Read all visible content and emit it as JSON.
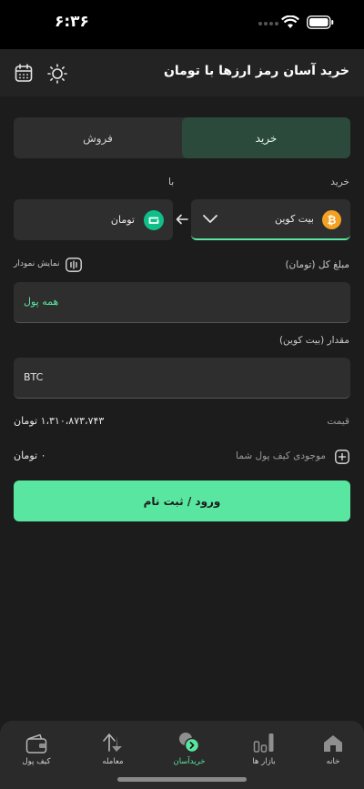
{
  "status_bar": {
    "time": "۶:۳۶"
  },
  "header": {
    "title": "خرید آسان رمز ارزها با تومان"
  },
  "tabs": {
    "buy": "خرید",
    "sell": "فروش"
  },
  "labels": {
    "buy": "خرید",
    "with": "با"
  },
  "coin": {
    "name": "بیت کوین",
    "symbol": "₿"
  },
  "fiat": {
    "name": "تومان"
  },
  "total": {
    "label": "مبلغ کل (تومان)",
    "chart_toggle": "نمایش نمودار",
    "value": "همه پول"
  },
  "amount": {
    "label": "مقدار (بیت کوین)",
    "value": "BTC"
  },
  "price": {
    "label": "قیمت",
    "value": "۱،۳۱۰،۸۷۳،۷۴۳ تومان"
  },
  "balance": {
    "label": "موجودی کیف پول شما",
    "value": "۰ تومان"
  },
  "login_button": "ورود / ثبت نام",
  "nav": {
    "home": "خانه",
    "markets": "بازار ها",
    "easy_buy": "خریدآسان",
    "trade": "معامله",
    "wallet": "کیف پول"
  },
  "colors": {
    "accent": "#59e6a0",
    "active_tab": "#2c4a3c",
    "btc": "#f2a122",
    "toman": "#0fbf8a"
  }
}
